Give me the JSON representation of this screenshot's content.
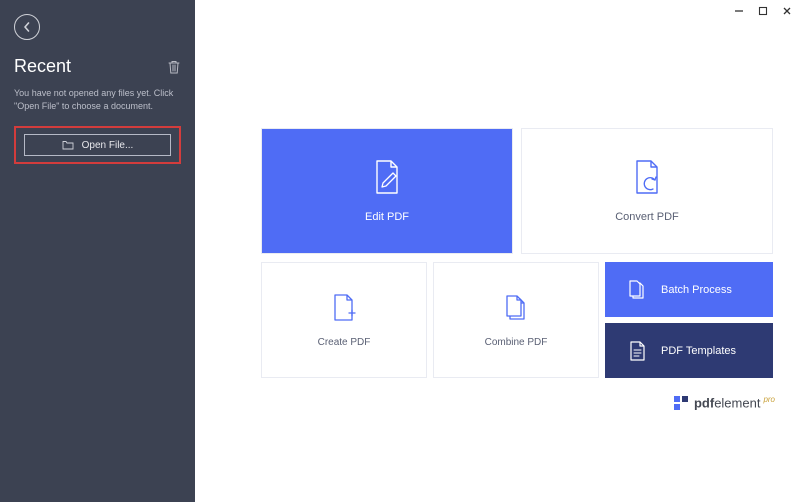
{
  "sidebar": {
    "title": "Recent",
    "message": "You have not opened any files yet. Click \"Open File\" to choose a document.",
    "open_file_label": "Open File..."
  },
  "tiles": {
    "edit": "Edit PDF",
    "convert": "Convert PDF",
    "create": "Create PDF",
    "combine": "Combine PDF",
    "batch": "Batch Process",
    "templates": "PDF Templates"
  },
  "brand": {
    "bold": "pdf",
    "rest": "element",
    "badge": "pro"
  },
  "colors": {
    "sidebar_bg": "#3c4252",
    "accent": "#4f6cf5",
    "dark_tile": "#2e3a73",
    "highlight": "#d33c3c"
  }
}
